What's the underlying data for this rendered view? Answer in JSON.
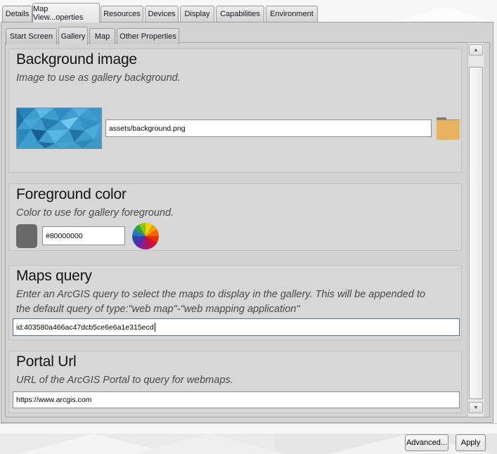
{
  "tabs": {
    "primary": [
      "Details",
      "Map View...operties",
      "Resources",
      "Devices",
      "Display",
      "Capabilities",
      "Environment"
    ],
    "primary_active": "Map View...operties",
    "secondary": [
      "Start Screen",
      "Gallery",
      "Map",
      "Other Properties"
    ],
    "secondary_active": "Gallery"
  },
  "sections": {
    "background_image": {
      "title": "Background image",
      "description": "Image to use as gallery background.",
      "path_value": "assets/background.png",
      "browse_icon": "folder-icon"
    },
    "foreground_color": {
      "title": "Foreground color",
      "description": "Color to use for gallery foreground.",
      "color_value": "#80000000",
      "swatch_color": "#696969",
      "picker_icon": "color-wheel-icon"
    },
    "maps_query": {
      "title": "Maps query",
      "description": "Enter an ArcGIS query to select the maps to display in the gallery. This will be appended to the default query of type:\"web map\"-\"web mapping application\"",
      "query_value": "id:403580a466ac47dcb5ce6e6a1e315ecd",
      "focused": true
    },
    "portal_url": {
      "title": "Portal Url",
      "description": "URL of the ArcGIS Portal to query for webmaps.",
      "url_value": "https://www.arcgis.com"
    }
  },
  "scrollbar": {
    "up_glyph": "▲",
    "down_glyph": "▼"
  },
  "footer": {
    "advanced_label": "Advanced...",
    "apply_label": "Apply"
  },
  "colors": {
    "panel_gray": "#d3d3d3",
    "focus_border": "#44729e",
    "folder_orange": "#e9b25e",
    "swatch_gray": "#696969",
    "thumbnail_blues": [
      "#1f6fa5",
      "#2b82b8",
      "#3e9ccf",
      "#5cb8e4",
      "#77c9ec"
    ]
  }
}
